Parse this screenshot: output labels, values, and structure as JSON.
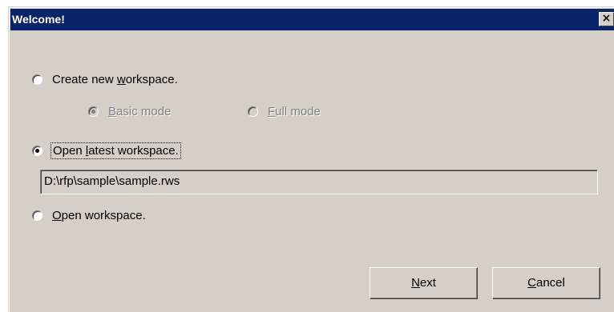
{
  "window": {
    "title": "Welcome!",
    "close_glyph": "×"
  },
  "options": {
    "create_new": {
      "prefix": "Create new ",
      "accel": "w",
      "suffix": "orkspace.",
      "checked": false
    },
    "basic_mode": {
      "prefix": "",
      "accel": "B",
      "suffix": "asic mode",
      "checked": true,
      "disabled": true
    },
    "full_mode": {
      "prefix": "",
      "accel": "F",
      "suffix": "ull mode",
      "checked": false,
      "disabled": true
    },
    "open_latest": {
      "prefix": "Open ",
      "accel": "l",
      "suffix": "atest workspace.",
      "checked": true
    },
    "open_workspace": {
      "prefix": "",
      "accel": "O",
      "suffix": "pen workspace.",
      "checked": false
    }
  },
  "latest_path": "D:\\rfp\\sample\\sample.rws",
  "buttons": {
    "next": {
      "accel": "N",
      "suffix": "ext"
    },
    "cancel": {
      "accel": "C",
      "suffix": "ancel"
    }
  },
  "icons": {
    "close": "close-icon",
    "radio": "radio-button-icon"
  },
  "colors": {
    "title_bar": "#0a246a",
    "dialog_bg": "#d4d0c8",
    "disabled_text": "#808080"
  }
}
